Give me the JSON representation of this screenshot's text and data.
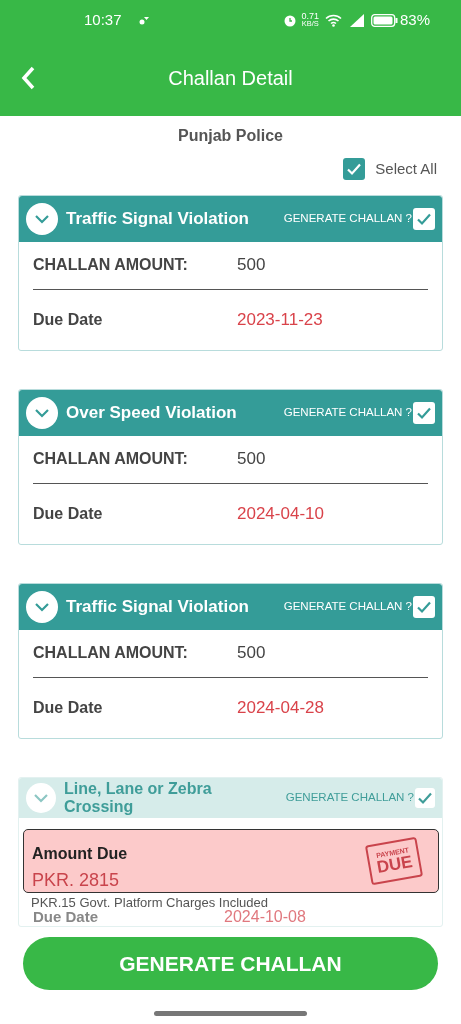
{
  "status_bar": {
    "time": "10:37",
    "speed_value": "0.71",
    "speed_unit": "KB/S",
    "battery": "83%"
  },
  "header": {
    "title": "Challan Detail"
  },
  "agency": "Punjab Police",
  "select_all": {
    "label": "Select All",
    "checked": true
  },
  "challans": [
    {
      "title": "Traffic Signal Violation",
      "generate_label": "GENERATE CHALLAN ?",
      "checked": true,
      "amount_label": "CHALLAN AMOUNT:",
      "amount": "500",
      "due_label": "Due Date",
      "due_date": "2023-11-23"
    },
    {
      "title": "Over Speed Violation",
      "generate_label": "GENERATE CHALLAN ?",
      "checked": true,
      "amount_label": "CHALLAN AMOUNT:",
      "amount": "500",
      "due_label": "Due Date",
      "due_date": "2024-04-10"
    },
    {
      "title": "Traffic Signal Violation",
      "generate_label": "GENERATE CHALLAN ?",
      "checked": true,
      "amount_label": "CHALLAN AMOUNT:",
      "amount": "500",
      "due_label": "Due Date",
      "due_date": "2024-04-28"
    },
    {
      "title": "Line, Lane or Zebra Crossing",
      "dimmed": true,
      "generate_label": "GENERATE CHALLAN ?",
      "checked": true,
      "due_label": "Due Date",
      "due_date": "2024-10-08"
    }
  ],
  "summary": {
    "label": "Amount Due",
    "amount": "PKR. 2815",
    "stamp_top": "PAYMENT",
    "stamp_bottom": "DUE",
    "note": "PKR.15 Govt. Platform Charges Included"
  },
  "button": "GENERATE CHALLAN"
}
